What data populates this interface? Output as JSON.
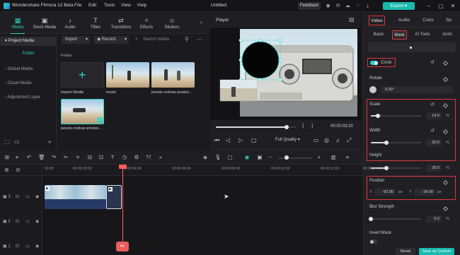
{
  "titlebar": {
    "app_name": "Wondershare Filmora 12 Beta",
    "menus": [
      "File",
      "Edit",
      "Tools",
      "View",
      "Help"
    ],
    "doc_title": "Untitled",
    "feedback": "Feedback",
    "export": "Export"
  },
  "media_tabs": [
    {
      "label": "Media",
      "icon": "media-icon"
    },
    {
      "label": "Stock Media",
      "icon": "stock-media-icon"
    },
    {
      "label": "Audio",
      "icon": "audio-icon"
    },
    {
      "label": "Titles",
      "icon": "titles-icon"
    },
    {
      "label": "Transitions",
      "icon": "transitions-icon"
    },
    {
      "label": "Effects",
      "icon": "effects-icon"
    },
    {
      "label": "Stickers",
      "icon": "stickers-icon"
    }
  ],
  "sidebar": {
    "project_media": "Project Media",
    "folder": "Folder",
    "items": [
      "Global Media",
      "Cloud Media",
      "Adjustment Layer"
    ]
  },
  "media_toolbar": {
    "import": "Import",
    "record": "Record",
    "search_placeholder": "Search media",
    "folder_label": "Folder"
  },
  "media_items": [
    {
      "label": "Import Media"
    },
    {
      "label": "music"
    },
    {
      "label": "pexels-rodnae-produc..."
    },
    {
      "label": "pexels-rodnae-produc..."
    }
  ],
  "player": {
    "label": "Player",
    "timecode": "00:00:03:20",
    "quality": "Full Quality",
    "progress": 0.88
  },
  "right_panel": {
    "tabs": [
      "Video",
      "Audio",
      "Color",
      "Sp"
    ],
    "subtabs": [
      "Basic",
      "Mask",
      "AI Tools",
      "Anim"
    ],
    "mask_shape": "Circle",
    "rotate": {
      "label": "Rotate",
      "value": "0.00°"
    },
    "scale": {
      "label": "Scale",
      "value": "14.5",
      "unit": "%",
      "level": 0.145
    },
    "width": {
      "label": "Width",
      "value": "30.0",
      "unit": "%",
      "level": 0.3
    },
    "height": {
      "label": "Height",
      "value": "30.0",
      "unit": "%",
      "level": 0.3
    },
    "position": {
      "label": "Position",
      "x_label": "X",
      "x_value": "-62.00",
      "x_unit": "px",
      "y_label": "Y",
      "y_value": "-34.00",
      "y_unit": "px"
    },
    "blur": {
      "label": "Blur Strength",
      "value": "0.0",
      "unit": "%",
      "level": 0
    },
    "invert": "Invert Mask",
    "reset": "Reset",
    "save": "Save as Custom"
  },
  "timeline": {
    "ticks": [
      "00:00",
      "00:00:02:00",
      "00:00:04:00",
      "00:00:06:00",
      "00:00:08:00",
      "00:00:10:00",
      "00:00:12:00",
      "00:00:14:00"
    ],
    "tracks": [
      "3",
      "2",
      "1"
    ]
  },
  "colors": {
    "accent": "#2ed1c6",
    "highlight": "#e1353d",
    "playhead": "#ff5c5c"
  }
}
